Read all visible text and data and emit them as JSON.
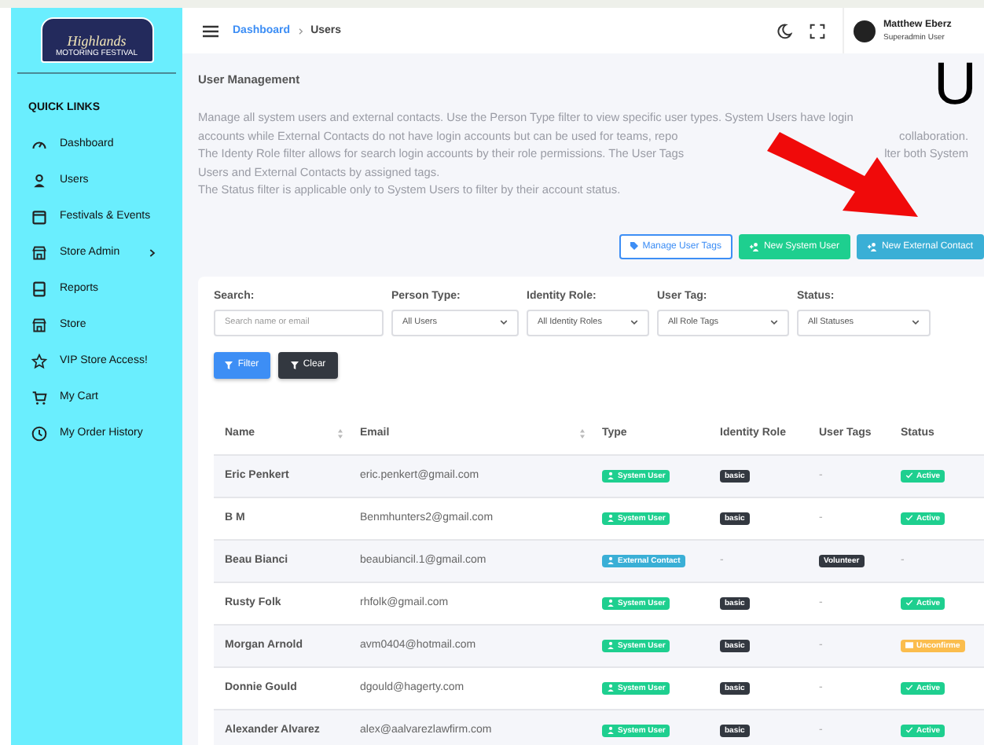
{
  "logo": {
    "title": "Highlands",
    "subtitle": "MOTORING FESTIVAL"
  },
  "sidebar": {
    "heading": "QUICK LINKS",
    "items": [
      {
        "label": "Dashboard",
        "has_submenu": false
      },
      {
        "label": "Users",
        "has_submenu": false
      },
      {
        "label": "Festivals & Events",
        "has_submenu": false
      },
      {
        "label": "Store Admin",
        "has_submenu": true
      },
      {
        "label": "Reports",
        "has_submenu": false
      },
      {
        "label": "Store",
        "has_submenu": false
      },
      {
        "label": "VIP Store Access!",
        "has_submenu": false
      },
      {
        "label": "My Cart",
        "has_submenu": false
      },
      {
        "label": "My Order History",
        "has_submenu": false
      }
    ]
  },
  "breadcrumb": [
    "Dashboard",
    "Users"
  ],
  "user": {
    "name": "Matthew Eberz",
    "role": "Superadmin User"
  },
  "page_title": "User Management",
  "description": [
    [
      {
        "text": "Manage all system users and external contacts. Use the Person Type filter to view specific user types. System Users have login"
      }
    ],
    [
      {
        "text": "accounts while External Contacts do not have login accounts but can be used for teams, repo"
      },
      {
        "text": "collaboration."
      }
    ],
    [
      {
        "text": "The Identy Role filter allows for search login accounts by their role permissions. The User Tags"
      },
      {
        "text": "lter both System"
      }
    ],
    [
      {
        "text": "Users and External Contacts by assigned tags."
      }
    ],
    [
      {
        "text": "The Status filter is applicable only to System Users to filter by their account status."
      }
    ]
  ],
  "annotation_letter": "U",
  "actions": [
    {
      "label": "Manage User Tags",
      "kind": "outline"
    },
    {
      "label": "New System User",
      "kind": "green"
    },
    {
      "label": "New External Contact",
      "kind": "teal"
    }
  ],
  "filters": [
    {
      "label": "Search:",
      "kind": "text",
      "placeholder": "Search name or email"
    },
    {
      "label": "Person Type:",
      "kind": "select",
      "value": "All Users"
    },
    {
      "label": "Identity Role:",
      "kind": "select",
      "value": "All Identity Roles"
    },
    {
      "label": "User Tag:",
      "kind": "select",
      "value": "All Role Tags"
    },
    {
      "label": "Status:",
      "kind": "select",
      "value": "All Statuses"
    }
  ],
  "filter_buttons": [
    {
      "label": "Filter",
      "kind": "primary"
    },
    {
      "label": "Clear",
      "kind": "dark"
    }
  ],
  "table": {
    "columns": [
      {
        "label": "Name",
        "sortable": true
      },
      {
        "label": "Email",
        "sortable": true
      },
      {
        "label": "Type",
        "sortable": false
      },
      {
        "label": "Identity Role",
        "sortable": false
      },
      {
        "label": "User Tags",
        "sortable": false
      },
      {
        "label": "Status",
        "sortable": false
      }
    ],
    "rows": [
      {
        "name": "Eric Penkert",
        "email": "eric.penkert@gmail.com",
        "type": {
          "label": "System User",
          "kind": "system"
        },
        "role": "basic",
        "tags": "-",
        "status": {
          "label": "Active",
          "kind": "active"
        }
      },
      {
        "name": "B M",
        "email": "Benmhunters2@gmail.com",
        "type": {
          "label": "System User",
          "kind": "system"
        },
        "role": "basic",
        "tags": "-",
        "status": {
          "label": "Active",
          "kind": "active"
        }
      },
      {
        "name": "Beau Bianci",
        "email": "beaubiancil.1@gmail.com",
        "type": {
          "label": "External Contact",
          "kind": "external"
        },
        "role": "-",
        "tags": "Volunteer",
        "status": {
          "label": "-",
          "kind": "none"
        }
      },
      {
        "name": "Rusty Folk",
        "email": "rhfolk@gmail.com",
        "type": {
          "label": "System User",
          "kind": "system"
        },
        "role": "basic",
        "tags": "-",
        "status": {
          "label": "Active",
          "kind": "active"
        }
      },
      {
        "name": "Morgan Arnold",
        "email": "avm0404@hotmail.com",
        "type": {
          "label": "System User",
          "kind": "system"
        },
        "role": "basic",
        "tags": "-",
        "status": {
          "label": "Unconfirme",
          "kind": "unconfirmed"
        }
      },
      {
        "name": "Donnie Gould",
        "email": "dgould@hagerty.com",
        "type": {
          "label": "System User",
          "kind": "system"
        },
        "role": "basic",
        "tags": "-",
        "status": {
          "label": "Active",
          "kind": "active"
        }
      },
      {
        "name": "Alexander Alvarez",
        "email": "alex@aalvarezlawfirm.com",
        "type": {
          "label": "System User",
          "kind": "system"
        },
        "role": "basic",
        "tags": "-",
        "status": {
          "label": "Active",
          "kind": "active"
        }
      }
    ]
  }
}
